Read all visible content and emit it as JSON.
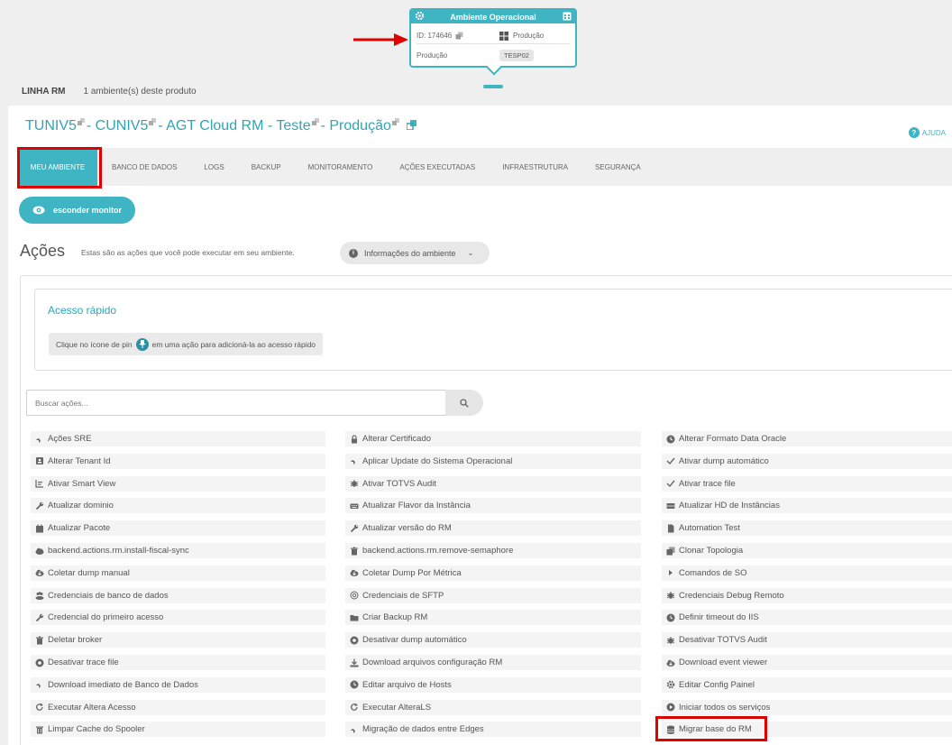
{
  "env_card": {
    "title": "Ambiente Operacional",
    "id_label": "ID: 174646",
    "os_label": "Produção",
    "env_label": "Produção",
    "env_tag": "TESP02"
  },
  "product_line": {
    "name": "LINHA RM",
    "count_text": "1 ambiente(s) deste produto"
  },
  "header": {
    "title_parts": [
      "TUNIV5",
      " - CUNIV5",
      " - AGT Cloud RM - Teste",
      " - Produção"
    ],
    "help": "AJUDA"
  },
  "tabs": [
    "MEU AMBIENTE",
    "BANCO DE DADOS",
    "LOGS",
    "BACKUP",
    "MONITORAMENTO",
    "AÇÕES EXECUTADAS",
    "INFRAESTRUTURA",
    "SEGURANÇA"
  ],
  "monitor_button": "esconder monitor",
  "actions_section": {
    "title": "Ações",
    "description": "Estas são as ações que você pode executar em seu ambiente.",
    "info_button": "Informações do ambiente"
  },
  "quick_access": {
    "title": "Acesso rápido",
    "hint_before": "Clique no ícone de pin",
    "hint_after": "em uma ação para adicioná-la ao acesso rápido"
  },
  "search": {
    "placeholder": "Buscar ações..."
  },
  "actions": [
    [
      "Ações SRE",
      "Alterar Certificado",
      "Alterar Formato Data Oracle"
    ],
    [
      "Alterar Tenant Id",
      "Aplicar Update do Sistema Operacional",
      "Ativar dump automático"
    ],
    [
      "Ativar Smart View",
      "Ativar TOTVS Audit",
      "Ativar trace file"
    ],
    [
      "Atualizar dominio",
      "Atualizar Flavor da Instância",
      "Atualizar HD de Instâncias"
    ],
    [
      "Atualizar Pacote",
      "Atualizar versão do RM",
      "Automation Test"
    ],
    [
      "backend.actions.rm.install-fiscal-sync",
      "backend.actions.rm.remove-semaphore",
      "Clonar Topologia"
    ],
    [
      "Coletar dump manual",
      "Coletar Dump Por Métrica",
      "Comandos de SO"
    ],
    [
      "Credenciais de banco de dados",
      "Credenciais de SFTP",
      "Credenciais Debug Remoto"
    ],
    [
      "Credencial do primeiro acesso",
      "Criar Backup RM",
      "Definir timeout do IIS"
    ],
    [
      "Deletar broker",
      "Desativar dump automático",
      "Desativar TOTVS Audit"
    ],
    [
      "Desativar trace file",
      "Download arquivos configuração RM",
      "Download event viewer"
    ],
    [
      "Download imediato de Banco de Dados",
      "Editar arquivo de Hosts",
      "Editar Config Painel"
    ],
    [
      "Executar Altera Acesso",
      "Executar AlteraLS",
      "Iniciar todos os serviços"
    ],
    [
      "Limpar Cache do Spooler",
      "Migração de dados entre Edges",
      "Migrar base do RM"
    ]
  ],
  "action_icons": [
    [
      "rocket-icon",
      "lock-icon",
      "clock-icon"
    ],
    [
      "id-badge-icon",
      "rocket-icon",
      "check-icon"
    ],
    [
      "chart-icon",
      "bug-icon",
      "check-icon"
    ],
    [
      "wrench-icon",
      "keyboard-icon",
      "hdd-icon"
    ],
    [
      "calendar-icon",
      "wrench-icon",
      "file-icon"
    ],
    [
      "cloud-icon",
      "trash-icon",
      "copy-icon"
    ],
    [
      "cloud-download-icon",
      "cloud-download-icon",
      "caret-right-icon"
    ],
    [
      "users-icon",
      "at-icon",
      "bug-icon"
    ],
    [
      "wrench-icon",
      "folder-icon",
      "clock-icon"
    ],
    [
      "trash-icon",
      "circle-dot-icon",
      "bug-icon"
    ],
    [
      "circle-dot-icon",
      "download-icon",
      "cloud-download-icon"
    ],
    [
      "rocket-icon",
      "clock-icon",
      "gear-icon"
    ],
    [
      "redo-icon",
      "redo-icon",
      "play-circle-icon"
    ],
    [
      "trash-alt-icon",
      "rocket-icon",
      "database-icon"
    ]
  ],
  "colors": {
    "accent": "#3fb4c2",
    "highlight": "#e00000",
    "background": "#efefef"
  }
}
